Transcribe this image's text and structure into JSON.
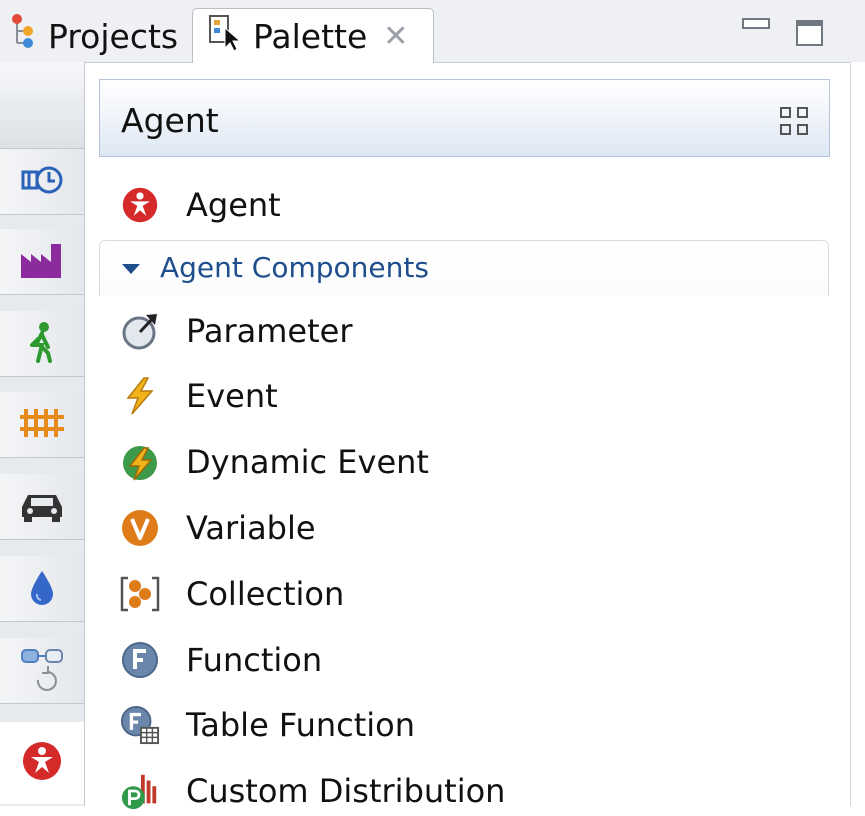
{
  "tabs": {
    "projects": {
      "label": "Projects",
      "icon": "projects-tree-icon"
    },
    "palette": {
      "label": "Palette",
      "icon": "palette-icon",
      "close_glyph": "✕"
    }
  },
  "window_controls": [
    "minimize",
    "maximize"
  ],
  "sidebar": {
    "items": [
      {
        "icon": "system-dynamics-icon",
        "color": "#2a62b8"
      },
      {
        "icon": "factory-icon",
        "color": "#8b2b9e"
      },
      {
        "icon": "pedestrian-icon",
        "color": "#2e9a2e"
      },
      {
        "icon": "rail-track-icon",
        "color": "#e58a1b"
      },
      {
        "icon": "car-icon",
        "color": "#333333"
      },
      {
        "icon": "fluid-drop-icon",
        "color": "#3567c9"
      },
      {
        "icon": "statechart-icon",
        "color": "#6a93c9"
      },
      {
        "icon": "agent-icon",
        "color": "#d42a2a",
        "active": true
      }
    ]
  },
  "palette": {
    "header_title": "Agent",
    "top_item": {
      "label": "Agent",
      "icon": "agent-icon"
    },
    "section": {
      "label": "Agent Components",
      "expanded": true,
      "items": [
        {
          "label": "Parameter",
          "icon": "parameter-icon"
        },
        {
          "label": "Event",
          "icon": "event-icon"
        },
        {
          "label": "Dynamic Event",
          "icon": "dynamic-event-icon"
        },
        {
          "label": "Variable",
          "icon": "variable-icon"
        },
        {
          "label": "Collection",
          "icon": "collection-icon"
        },
        {
          "label": "Function",
          "icon": "function-icon"
        },
        {
          "label": "Table Function",
          "icon": "table-function-icon"
        },
        {
          "label": "Custom Distribution",
          "icon": "custom-distribution-icon"
        }
      ]
    }
  },
  "colors": {
    "accent": "#1e4f8c",
    "header_gradient_end": "#dde7f3",
    "agent_red": "#d42a2a"
  }
}
